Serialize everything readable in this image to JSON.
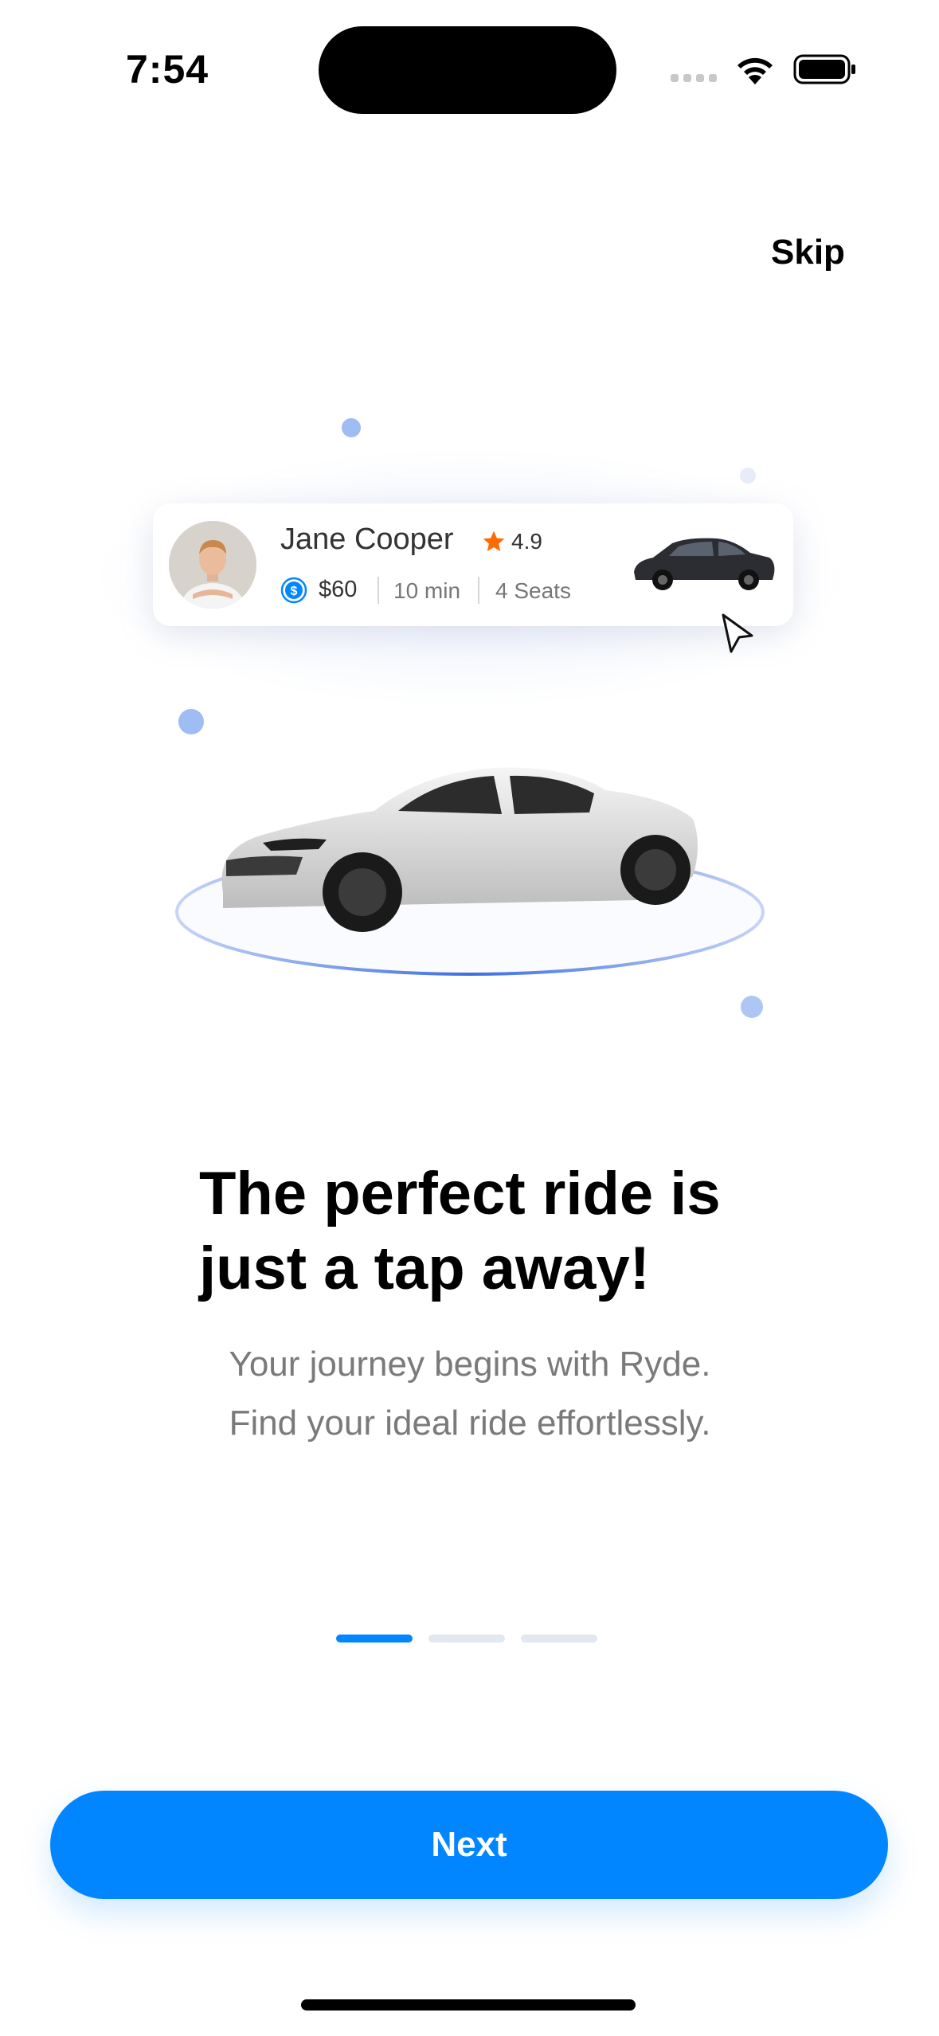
{
  "status_bar": {
    "time": "7:54"
  },
  "header": {
    "skip_label": "Skip"
  },
  "ride_card": {
    "driver_name": "Jane Cooper",
    "rating": "4.9",
    "price": "$60",
    "duration": "10 min",
    "seats": "4 Seats"
  },
  "onboarding": {
    "title_line1": "The perfect ride is",
    "title_line2": "just a tap away!",
    "subtitle_line1": "Your journey begins with Ryde.",
    "subtitle_line2": "Find your ideal ride effortlessly.",
    "current_page": 1,
    "total_pages": 3
  },
  "footer": {
    "next_label": "Next"
  },
  "colors": {
    "accent": "#0286FF",
    "inactive_dot": "#E2E8F0",
    "star": "#FF6B00",
    "decor_dot": "#9FBCF3"
  },
  "icons": [
    "wifi-icon",
    "battery-icon",
    "star-icon",
    "dollar-icon",
    "cursor-icon"
  ]
}
